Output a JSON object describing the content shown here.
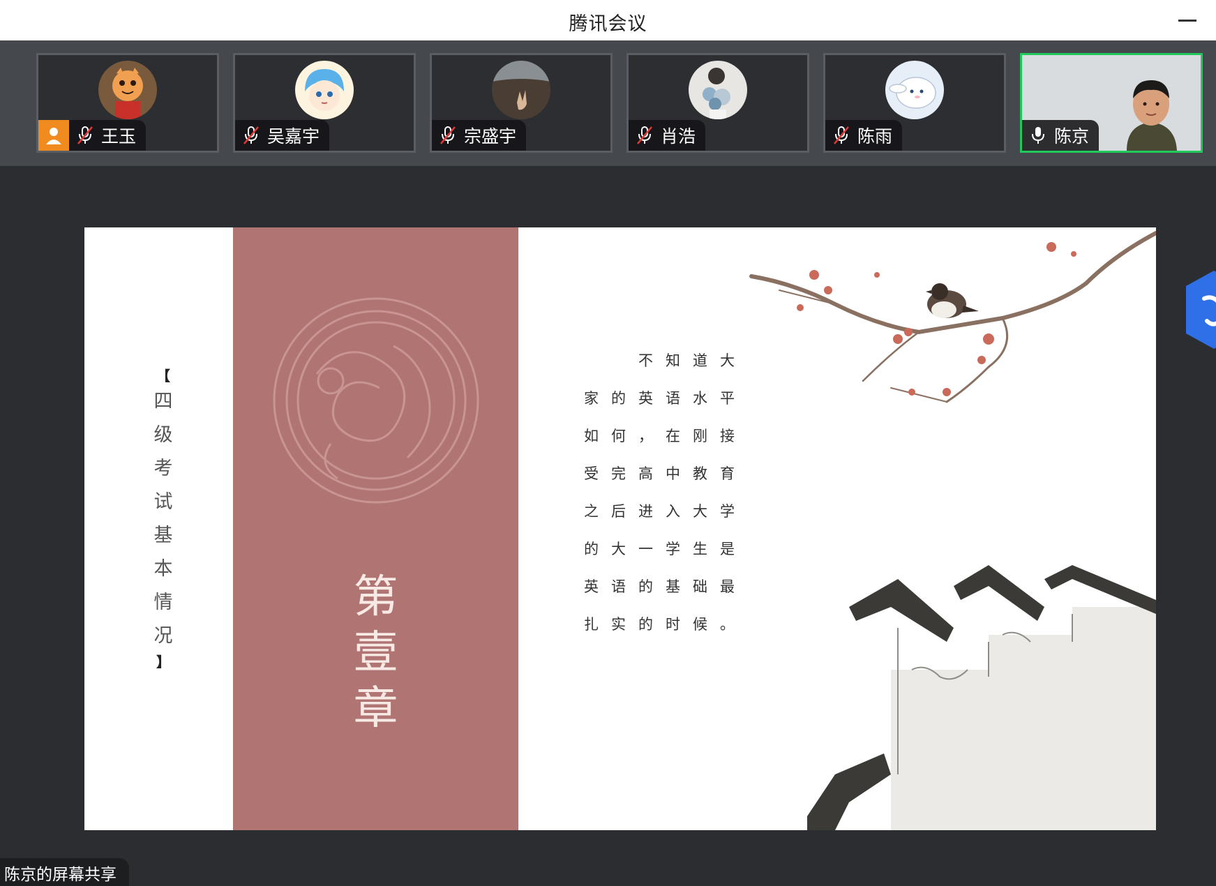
{
  "window": {
    "title": "腾讯会议"
  },
  "participants": [
    {
      "name": "王玉",
      "mic": "muted",
      "host_badge": true,
      "avatar": "tiger-avatar"
    },
    {
      "name": "吴嘉宇",
      "mic": "muted",
      "host_badge": false,
      "avatar": "anime-boy-avatar"
    },
    {
      "name": "宗盛宇",
      "mic": "muted",
      "host_badge": false,
      "avatar": "hand-landscape-avatar"
    },
    {
      "name": "肖浩",
      "mic": "muted",
      "host_badge": false,
      "avatar": "flowers-avatar"
    },
    {
      "name": "陈雨",
      "mic": "muted",
      "host_badge": false,
      "avatar": "cinnamoroll-avatar"
    },
    {
      "name": "陈京",
      "mic": "on",
      "host_badge": false,
      "avatar": "camera-video",
      "active_speaker": true
    }
  ],
  "slide": {
    "side_title_open": "【",
    "side_title_chars": [
      "四",
      "级",
      "考",
      "试",
      "基",
      "本",
      "情",
      "况"
    ],
    "side_title_close": "】",
    "chapter_chars": [
      "第",
      "壹",
      "章"
    ],
    "poem_lines": [
      "不知道大",
      "家的英语水平",
      "如何，在刚接",
      "受完高中教育",
      "之后进入大学",
      "的大一学生是",
      "英语的基础最",
      "扎实的时候。"
    ]
  },
  "share_label": "陈京的屏幕共享",
  "colors": {
    "rose_panel": "#b07473",
    "active_border": "#1fc95b",
    "host_badge": "#f08c1f",
    "strip_bg": "#45484d"
  }
}
